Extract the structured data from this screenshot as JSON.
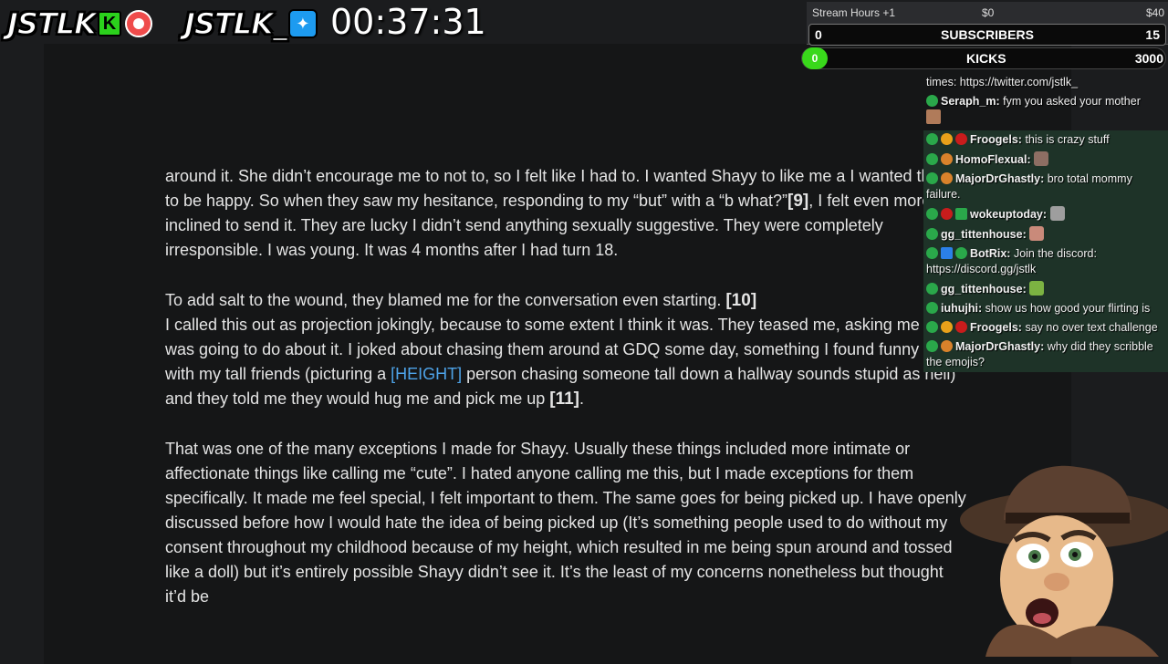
{
  "overlay": {
    "logo1": "JSTLK",
    "logo2": "JSTLK_",
    "timer": "00:37:31"
  },
  "goals": {
    "label": "Stream Hours +1",
    "min_amount": "$0",
    "max_amount": "$40",
    "subs_current": "0",
    "subs_label": "SUBSCRIBERS",
    "subs_target": "15"
  },
  "kicks": {
    "current": "0",
    "label": "KICKS",
    "target": "3000"
  },
  "chat": [
    {
      "name": "",
      "text": "times: https://twitter.com/jstlk_",
      "hl": false
    },
    {
      "name": "Seraph_m:",
      "text": "fym you asked your mother",
      "hl": false
    },
    {
      "name": "Froogels:",
      "text": "this is crazy stuff",
      "hl": true
    },
    {
      "name": "HomoFlexual:",
      "text": "",
      "hl": true
    },
    {
      "name": "MajorDrGhastly:",
      "text": "bro total mommy failure.",
      "hl": true
    },
    {
      "name": "wokeuptoday:",
      "text": "",
      "hl": true
    },
    {
      "name": "gg_tittenhouse:",
      "text": "",
      "hl": true
    },
    {
      "name": "BotRix:",
      "text": "Join the discord: https://discord.gg/jstlk",
      "hl": true
    },
    {
      "name": "gg_tittenhouse:",
      "text": "",
      "hl": true
    },
    {
      "name": "iuhujhi:",
      "text": "show us how good your flirting is",
      "hl": true
    },
    {
      "name": "Froogels:",
      "text": "say no over text challenge",
      "hl": true
    },
    {
      "name": "MajorDrGhastly:",
      "text": "why did they scribble the emojis?",
      "hl": true
    }
  ],
  "document": {
    "p1": "around it. She didn’t encourage me to not to, so I felt like I had to. I wanted Shayy to like me a I wanted them to be happy. So when they saw my hesitance, responding to my “but” with a “b what?”",
    "ref9": "[9]",
    "p1b": ", I felt even more inclined to send it. They are lucky I didn’t send anything sexually suggestive. They were completely irresponsible. I was young. It was 4 months after I had turn 18.",
    "p2a": "To add salt to the wound, they blamed me for the conversation even starting. ",
    "ref10": "[10]",
    "p2b": "I called this out as projection jokingly, because to some extent I think it was. They teased me, asking me what I was going to do about it. I joked about chasing them around at GDQ some day, something I found funny to do with my tall friends (picturing a ",
    "height_link": "[HEIGHT]",
    "p2c": " person chasing someone tall down a hallway sounds stupid as hell) and they told me they would hug me and pick me up ",
    "ref11": "[11]",
    "p2d": ".",
    "p3": "That was one of the many exceptions I made for Shayy. Usually these things included more intimate or affectionate things like calling me “cute”. I hated anyone calling me this, but I made exceptions for them specifically. It made me feel special, I felt important to them. The same goes for being picked up. I have openly discussed before how I would hate the idea of being picked up (It’s something people used to do without my consent throughout my childhood because of my height, which resulted in me being spun around and tossed like a doll) but it’s entirely possible Shayy didn’t see it. It’s the least of my concerns nonetheless but thought it’d be"
  }
}
